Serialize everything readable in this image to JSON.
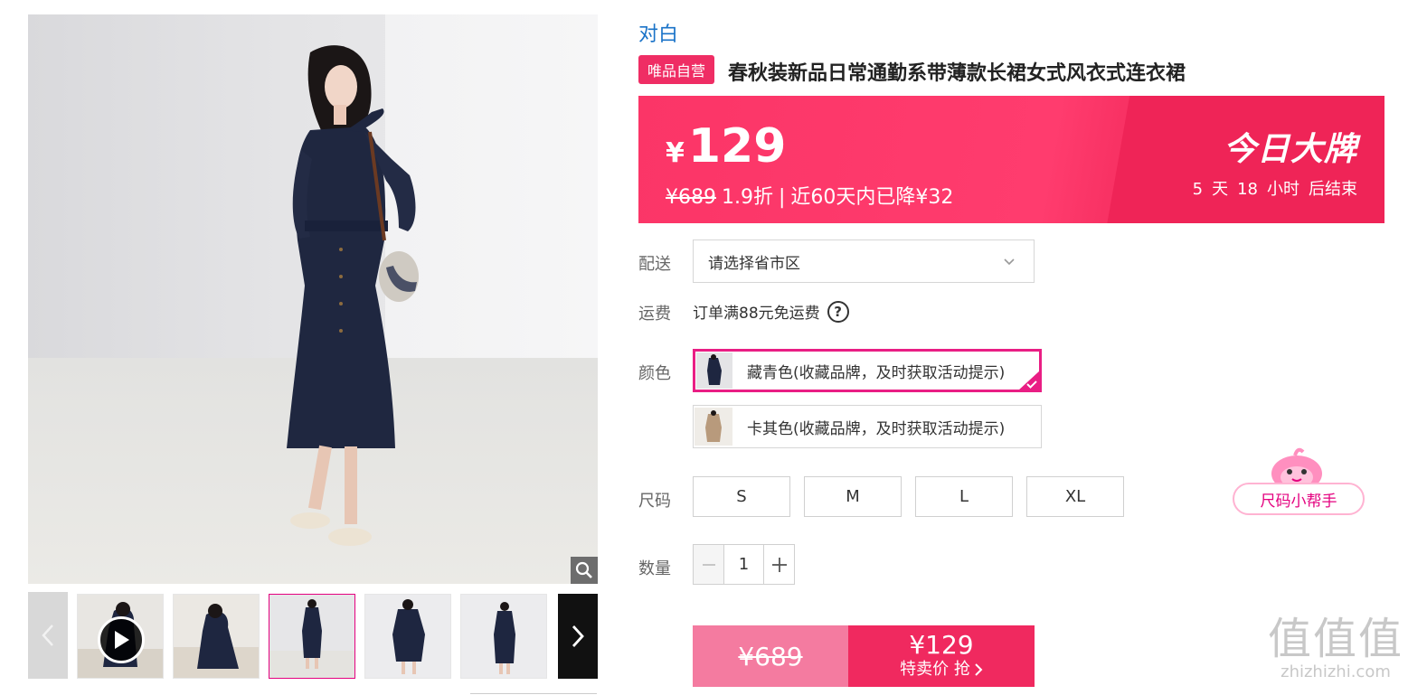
{
  "brand": "对白",
  "badge": "唯品自营",
  "title": "春秋装新品日常通勤系带薄款长裙女式风衣式连衣裙",
  "price": {
    "currency": "¥",
    "current": "129",
    "original": "¥689",
    "discount": "1.9折",
    "separator": "|",
    "drop_note": "近60天内已降¥32",
    "deal_name": "今日大牌",
    "countdown": {
      "days": "5",
      "days_unit": "天",
      "hours": "18",
      "hours_unit": "小时",
      "suffix": "后结束"
    }
  },
  "delivery": {
    "label": "配送",
    "placeholder": "请选择省市区"
  },
  "shipping": {
    "label": "运费",
    "text": "订单满88元免运费",
    "help": "?"
  },
  "color": {
    "label": "颜色",
    "options": [
      {
        "name": "藏青色(收藏品牌，及时获取活动提示)",
        "selected": true
      },
      {
        "name": "卡其色(收藏品牌，及时获取活动提示)",
        "selected": false
      }
    ]
  },
  "size": {
    "label": "尺码",
    "options": [
      "S",
      "M",
      "L",
      "XL"
    ],
    "helper": "尺码小帮手"
  },
  "quantity": {
    "label": "数量",
    "value": "1"
  },
  "buy": {
    "original": "¥689",
    "price": "¥129",
    "label": "特卖价 抢"
  },
  "watermark": {
    "line1": "值值值",
    "line2": "zhizhizhi.com"
  },
  "colors": {
    "accent": "#ef2d64",
    "banner": "#fb3567",
    "selected_border": "#e91e84",
    "brand_link": "#1a73c8"
  }
}
